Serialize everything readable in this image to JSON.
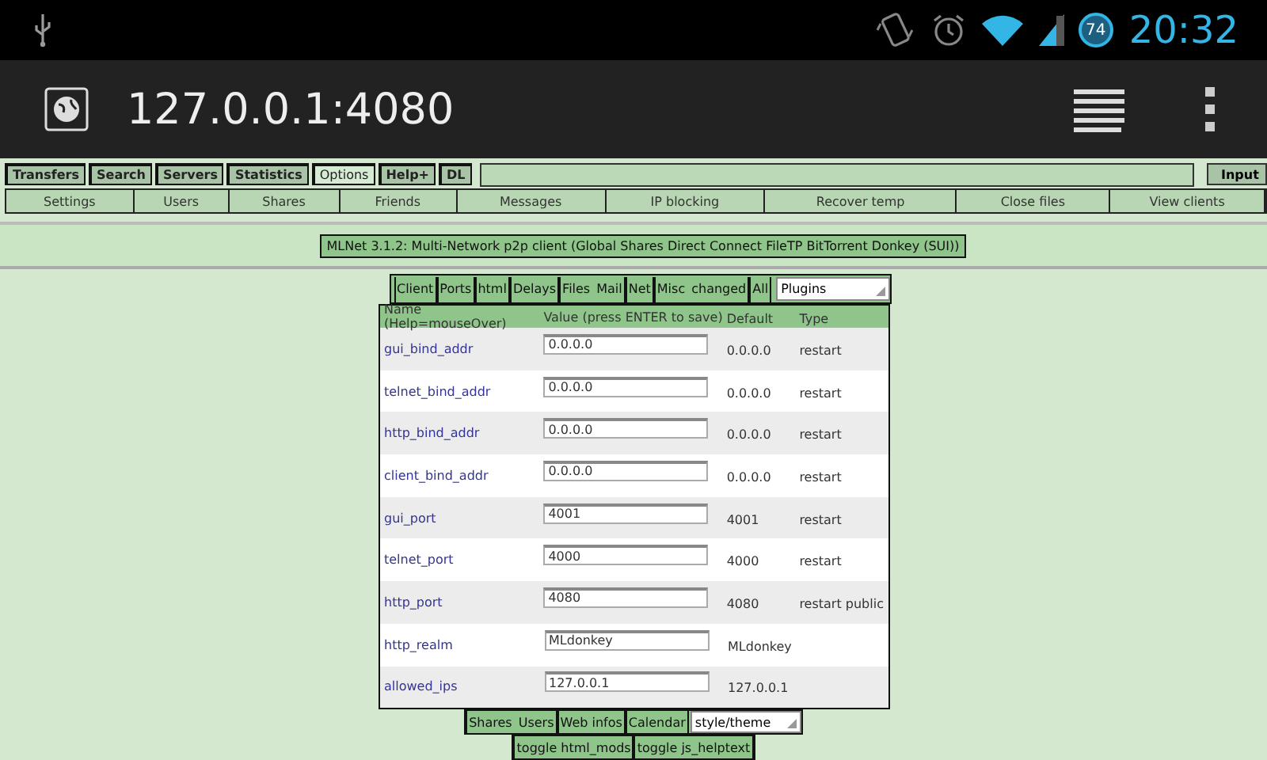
{
  "status_bar": {
    "battery": "74",
    "time": "20:32"
  },
  "address_bar": {
    "url": "127.0.0.1:4080"
  },
  "main_tabs": [
    {
      "label": "Transfers",
      "selected": false
    },
    {
      "label": "Search",
      "selected": false
    },
    {
      "label": "Servers",
      "selected": false
    },
    {
      "label": "Statistics",
      "selected": false
    },
    {
      "label": "Options",
      "selected": true
    },
    {
      "label": "Help+",
      "selected": false
    },
    {
      "label": "DL",
      "selected": false
    }
  ],
  "command_button": "Input",
  "sub_tabs": [
    "Settings",
    "Users",
    "Shares",
    "Friends",
    "Messages",
    "IP blocking",
    "Recover temp",
    "Close files",
    "View clients"
  ],
  "banner": "MLNet 3.1.2: Multi-Network p2p client (Global Shares Direct Connect FileTP BitTorrent Donkey (SUI))",
  "option_tabs": [
    [
      "Client"
    ],
    [
      "Ports"
    ],
    [
      "html"
    ],
    [
      "Delays"
    ],
    [
      "Files",
      "Mail"
    ],
    [
      "Net"
    ],
    [
      "Misc",
      "changed"
    ],
    [
      "All"
    ]
  ],
  "plugins_select": "Plugins",
  "table": {
    "columns": [
      "Name (Help=mouseOver)",
      "Value (press ENTER to save)",
      "Default",
      "Type"
    ],
    "rows": [
      {
        "name": "gui_bind_addr",
        "value": "0.0.0.0",
        "default": "0.0.0.0",
        "type": "restart"
      },
      {
        "name": "telnet_bind_addr",
        "value": "0.0.0.0",
        "default": "0.0.0.0",
        "type": "restart"
      },
      {
        "name": "http_bind_addr",
        "value": "0.0.0.0",
        "default": "0.0.0.0",
        "type": "restart"
      },
      {
        "name": "client_bind_addr",
        "value": "0.0.0.0",
        "default": "0.0.0.0",
        "type": "restart"
      },
      {
        "name": "gui_port",
        "value": "4001",
        "default": "4001",
        "type": "restart"
      },
      {
        "name": "telnet_port",
        "value": "4000",
        "default": "4000",
        "type": "restart"
      },
      {
        "name": "http_port",
        "value": "4080",
        "default": "4080",
        "type": "restart public"
      },
      {
        "name": "http_realm",
        "value": "MLdonkey",
        "default": "MLdonkey",
        "type": ""
      },
      {
        "name": "allowed_ips",
        "value": "127.0.0.1",
        "default": "127.0.0.1",
        "type": ""
      }
    ]
  },
  "bottom_tabs": [
    [
      "Shares",
      "Users"
    ],
    [
      "Web infos"
    ],
    [
      "Calendar"
    ]
  ],
  "theme_select": "style/theme",
  "toggles": [
    "toggle html_mods",
    "toggle js_helptext"
  ]
}
